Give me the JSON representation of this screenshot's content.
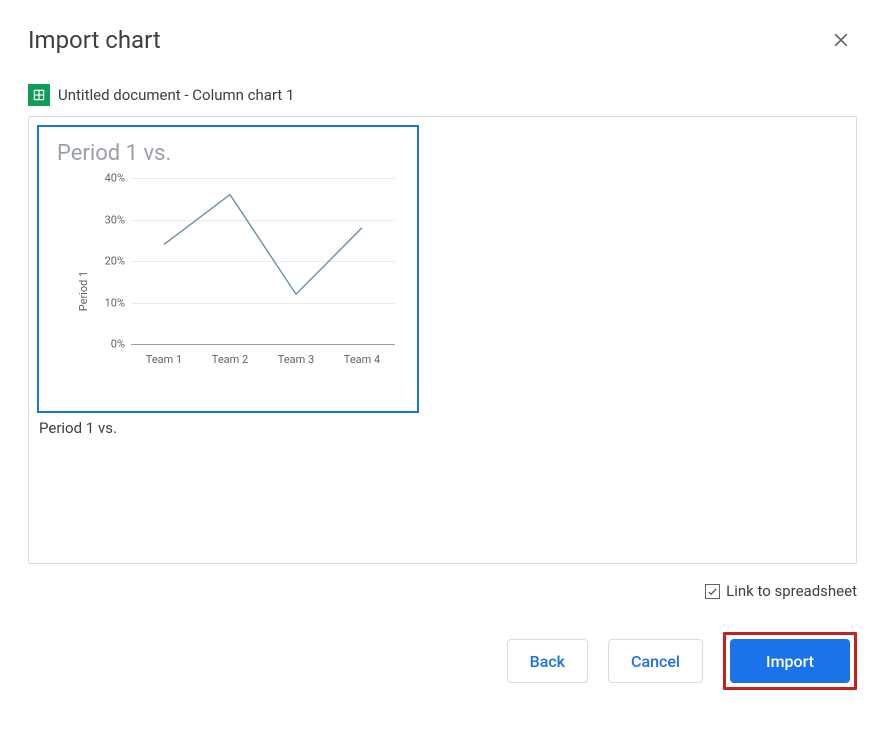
{
  "dialog": {
    "title": "Import chart",
    "source_label": "Untitled document - Column chart 1"
  },
  "chart_thumb": {
    "title": "Period 1 vs.",
    "caption": "Period 1 vs.",
    "yaxis_label": "Period 1",
    "yticks": [
      "40%",
      "30%",
      "20%",
      "10%",
      "0%"
    ],
    "xticks": [
      "Team 1",
      "Team 2",
      "Team 3",
      "Team 4"
    ]
  },
  "options": {
    "link_label": "Link to spreadsheet",
    "link_checked": true
  },
  "buttons": {
    "back": "Back",
    "cancel": "Cancel",
    "import": "Import"
  },
  "chart_data": {
    "type": "line",
    "title": "Period 1 vs.",
    "xlabel": "",
    "ylabel": "Period 1",
    "categories": [
      "Team 1",
      "Team 2",
      "Team 3",
      "Team 4"
    ],
    "values": [
      24,
      36,
      12,
      28
    ],
    "ylim": [
      0,
      40
    ],
    "yticks_percent": [
      0,
      10,
      20,
      30,
      40
    ]
  }
}
